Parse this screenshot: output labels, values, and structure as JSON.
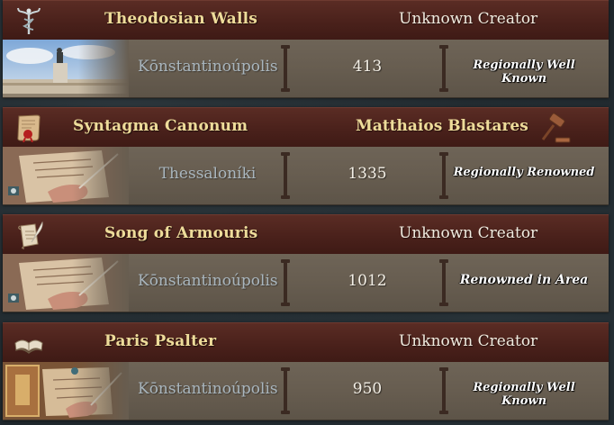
{
  "works": [
    {
      "name": "Theodosian Walls",
      "creator": "Unknown Creator",
      "creator_known": false,
      "type_icon": "caduceus-icon",
      "portrait": "city-statue-portrait",
      "location": "Kōnstantinoúpolis",
      "year": "413",
      "fame": "Regionally Well Known"
    },
    {
      "name": "Syntagma Canonum",
      "creator": "Matthaios Blastares",
      "creator_known": true,
      "creator_icon": "gavel-icon",
      "type_icon": "sealed-scroll-icon",
      "portrait": "writing-hand-portrait",
      "location": "Thessaloníki",
      "year": "1335",
      "fame": "Regionally Renowned"
    },
    {
      "name": "Song of Armouris",
      "creator": "Unknown Creator",
      "creator_known": false,
      "type_icon": "quill-scroll-icon",
      "portrait": "writing-hand-portrait",
      "location": "Kōnstantinoúpolis",
      "year": "1012",
      "fame": "Renowned in Area"
    },
    {
      "name": "Paris Psalter",
      "creator": "Unknown Creator",
      "creator_known": false,
      "type_icon": "open-book-icon",
      "portrait": "illuminated-book-portrait",
      "location": "Kōnstantinoúpolis",
      "year": "950",
      "fame": "Regionally Well Known"
    }
  ],
  "colors": {
    "header_bg": "#4a211b",
    "body_bg": "#675d50",
    "title_gold": "#eedc9a",
    "location_text": "#a9b6be",
    "year_text": "#f3efe6"
  }
}
